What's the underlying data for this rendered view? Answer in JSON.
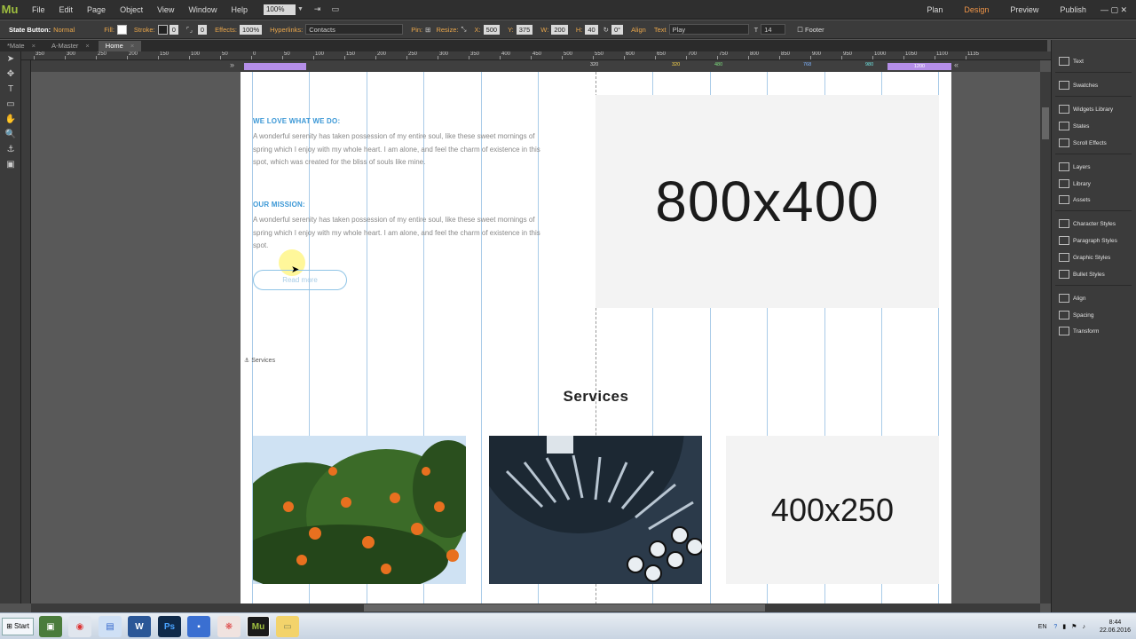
{
  "app": {
    "logo": "Mu"
  },
  "menu": {
    "items": [
      "File",
      "Edit",
      "Page",
      "Object",
      "View",
      "Window",
      "Help"
    ],
    "zoom": "100%"
  },
  "modes": {
    "plan": "Plan",
    "design": "Design",
    "preview": "Preview",
    "publish": "Publish"
  },
  "control": {
    "state_label": "State Button:",
    "state_value": "Normal",
    "fill": "Fill:",
    "stroke": "Stroke:",
    "stroke_value": "0",
    "corner_value": "0",
    "effects": "Effects:",
    "opacity": "100%",
    "hyperlinks": "Hyperlinks:",
    "hyperlink_value": "Contacts",
    "pin": "Pin:",
    "resize": "Resize:",
    "x_label": "X:",
    "x_value": "500",
    "y_label": "Y:",
    "y_value": "375",
    "w_label": "W:",
    "w_value": "200",
    "h_label": "H:",
    "h_value": "40",
    "rot_value": "0°",
    "align": "Align",
    "text": "Text",
    "font_value": "Play",
    "size_value": "14",
    "footer": "Footer"
  },
  "tabs": [
    {
      "label": "*Mate"
    },
    {
      "label": "A-Master"
    },
    {
      "label": "Home"
    }
  ],
  "rulers": {
    "top": [
      "350",
      "300",
      "250",
      "200",
      "150",
      "100",
      "50",
      "0",
      "50",
      "100",
      "150",
      "200",
      "250",
      "300",
      "350",
      "400",
      "450",
      "500",
      "550",
      "600",
      "650",
      "700",
      "750",
      "800",
      "850",
      "900",
      "950",
      "1000",
      "1050",
      "1100",
      "1135"
    ]
  },
  "breakpoints": {
    "center": "320",
    "marks": [
      "320",
      "480",
      "768",
      "980",
      "1200"
    ]
  },
  "content": {
    "h1": "WE LOVE WHAT WE DO:",
    "p1": "A wonderful serenity has taken possession of my entire soul, like these sweet mornings of spring which I enjoy with my whole heart. I am alone, and feel the charm of existence in this spot, which was created for the bliss of souls like mine.",
    "h2": "OUR MISSION:",
    "p2": "A wonderful serenity has taken possession of my entire soul, like these sweet mornings of spring which I enjoy with my whole heart. I am alone, and feel the charm of existence in this spot.",
    "button": "Read more",
    "placeholder_large": "800x400",
    "anchor": "Services",
    "services_title": "Services",
    "placeholder_small": "400x250"
  },
  "panel": {
    "items": [
      "Text",
      "Swatches",
      "Widgets Library",
      "States",
      "Scroll Effects",
      "Layers",
      "Library",
      "Assets",
      "Character Styles",
      "Paragraph Styles",
      "Graphic Styles",
      "Bullet Styles",
      "Align",
      "Spacing",
      "Transform"
    ]
  },
  "taskbar": {
    "start": "Start",
    "lang": "EN",
    "time": "8:44",
    "date": "22.06.2016"
  }
}
